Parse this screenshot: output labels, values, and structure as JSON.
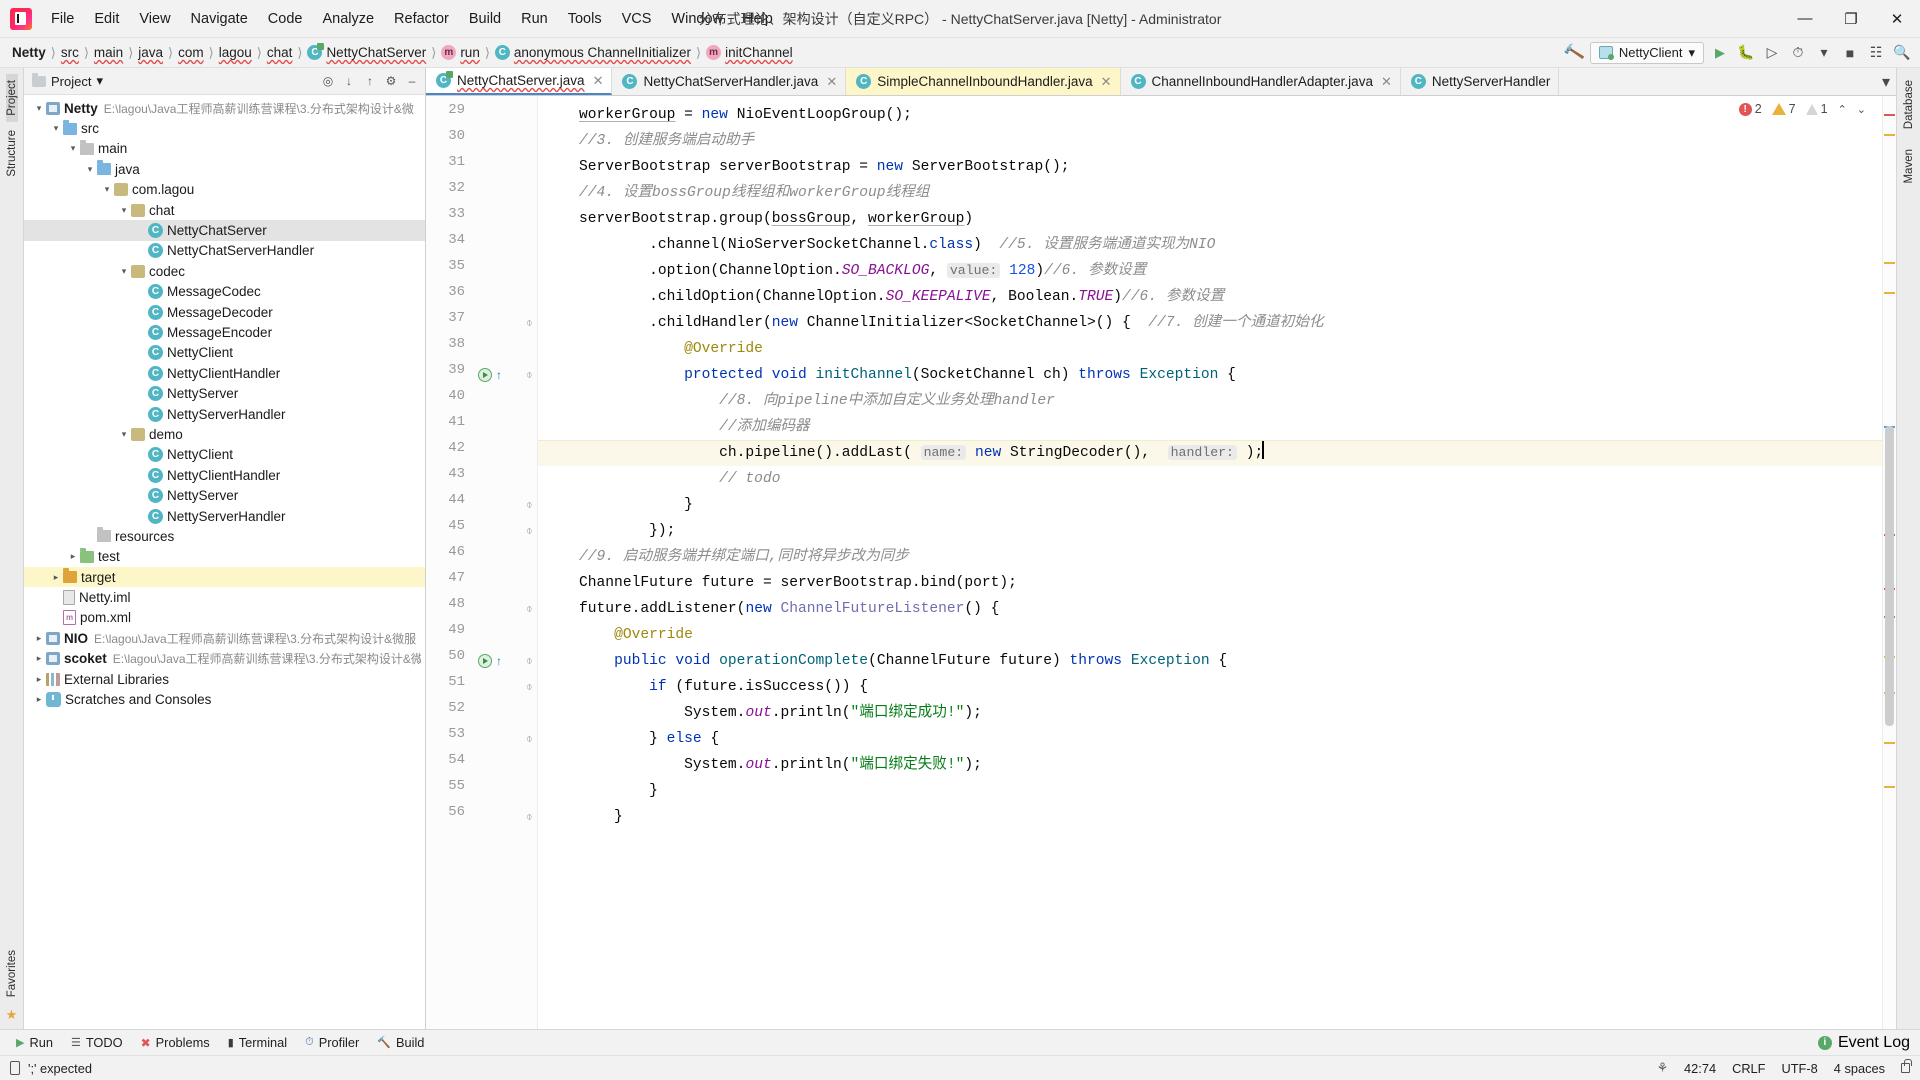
{
  "window": {
    "title": "分布式理论、架构设计（自定义RPC） - NettyChatServer.java [Netty] - Administrator",
    "minimize": "—",
    "maximize": "❐",
    "close": "✕"
  },
  "menubar": [
    {
      "label": "File"
    },
    {
      "label": "Edit"
    },
    {
      "label": "View"
    },
    {
      "label": "Navigate"
    },
    {
      "label": "Code"
    },
    {
      "label": "Analyze"
    },
    {
      "label": "Refactor"
    },
    {
      "label": "Build"
    },
    {
      "label": "Run"
    },
    {
      "label": "Tools"
    },
    {
      "label": "VCS"
    },
    {
      "label": "Window"
    },
    {
      "label": "Help"
    }
  ],
  "breadcrumb": [
    {
      "label": "Netty",
      "icon": "none",
      "bold": true,
      "wavy": false
    },
    {
      "label": "src",
      "icon": "none",
      "bold": false,
      "wavy": true
    },
    {
      "label": "main",
      "icon": "none",
      "bold": false,
      "wavy": true
    },
    {
      "label": "java",
      "icon": "none",
      "bold": false,
      "wavy": true
    },
    {
      "label": "com",
      "icon": "none",
      "bold": false,
      "wavy": true
    },
    {
      "label": "lagou",
      "icon": "none",
      "bold": false,
      "wavy": true
    },
    {
      "label": "chat",
      "icon": "none",
      "bold": false,
      "wavy": true
    },
    {
      "label": "NettyChatServer",
      "icon": "class",
      "bold": false,
      "wavy": true
    },
    {
      "label": "run",
      "icon": "method",
      "bold": false,
      "wavy": true
    },
    {
      "label": "anonymous ChannelInitializer",
      "icon": "anon",
      "bold": false,
      "wavy": true
    },
    {
      "label": "initChannel",
      "icon": "method",
      "bold": false,
      "wavy": true
    }
  ],
  "toolbar_right": {
    "hammer_icon": "build-hammer-icon",
    "run_config": "NettyClient",
    "dropdown_caret": "▾",
    "run_icon": "▶",
    "debug_icon": "debug-icon",
    "coverage_icon": "coverage-icon",
    "profile_icon": "profile-icon",
    "profile_caret": "▾",
    "stop_icon": "■",
    "layout_icon": "layout-icon",
    "search_icon": "⚲"
  },
  "left_rail": [
    "Project",
    "Structure",
    "Favorites"
  ],
  "right_rail": [
    "Database",
    "Maven"
  ],
  "project_panel": {
    "title": "Project",
    "caret": "▾",
    "actions": [
      "target-icon",
      "collapse-icon",
      "expand-icon",
      "settings-icon",
      "hide-icon"
    ],
    "tree": [
      {
        "depth": 0,
        "arrow": "open",
        "icon": "module",
        "label": "Netty",
        "sub": "E:\\lagou\\Java工程师高薪训练营课程\\3.分布式架构设计&微",
        "bold": true,
        "state": "normal"
      },
      {
        "depth": 1,
        "arrow": "open",
        "icon": "folder-blue",
        "label": "src",
        "sub": "",
        "state": "normal"
      },
      {
        "depth": 2,
        "arrow": "open",
        "icon": "folder-gray",
        "label": "main",
        "sub": "",
        "state": "normal"
      },
      {
        "depth": 3,
        "arrow": "open",
        "icon": "folder-blue",
        "label": "java",
        "sub": "",
        "state": "normal"
      },
      {
        "depth": 4,
        "arrow": "open",
        "icon": "package",
        "label": "com.lagou",
        "sub": "",
        "state": "normal"
      },
      {
        "depth": 5,
        "arrow": "open",
        "icon": "package",
        "label": "chat",
        "sub": "",
        "state": "normal"
      },
      {
        "depth": 6,
        "arrow": "none",
        "icon": "class",
        "label": "NettyChatServer",
        "sub": "",
        "state": "selected"
      },
      {
        "depth": 6,
        "arrow": "none",
        "icon": "class",
        "label": "NettyChatServerHandler",
        "sub": "",
        "state": "normal"
      },
      {
        "depth": 5,
        "arrow": "open",
        "icon": "package",
        "label": "codec",
        "sub": "",
        "state": "normal"
      },
      {
        "depth": 6,
        "arrow": "none",
        "icon": "class",
        "label": "MessageCodec",
        "sub": "",
        "state": "normal"
      },
      {
        "depth": 6,
        "arrow": "none",
        "icon": "class",
        "label": "MessageDecoder",
        "sub": "",
        "state": "normal"
      },
      {
        "depth": 6,
        "arrow": "none",
        "icon": "class",
        "label": "MessageEncoder",
        "sub": "",
        "state": "normal"
      },
      {
        "depth": 6,
        "arrow": "none",
        "icon": "class",
        "label": "NettyClient",
        "sub": "",
        "state": "normal"
      },
      {
        "depth": 6,
        "arrow": "none",
        "icon": "class",
        "label": "NettyClientHandler",
        "sub": "",
        "state": "normal"
      },
      {
        "depth": 6,
        "arrow": "none",
        "icon": "class",
        "label": "NettyServer",
        "sub": "",
        "state": "normal"
      },
      {
        "depth": 6,
        "arrow": "none",
        "icon": "class",
        "label": "NettyServerHandler",
        "sub": "",
        "state": "normal"
      },
      {
        "depth": 5,
        "arrow": "open",
        "icon": "package",
        "label": "demo",
        "sub": "",
        "state": "normal"
      },
      {
        "depth": 6,
        "arrow": "none",
        "icon": "class",
        "label": "NettyClient",
        "sub": "",
        "state": "normal"
      },
      {
        "depth": 6,
        "arrow": "none",
        "icon": "class",
        "label": "NettyClientHandler",
        "sub": "",
        "state": "normal"
      },
      {
        "depth": 6,
        "arrow": "none",
        "icon": "class",
        "label": "NettyServer",
        "sub": "",
        "state": "normal"
      },
      {
        "depth": 6,
        "arrow": "none",
        "icon": "class",
        "label": "NettyServerHandler",
        "sub": "",
        "state": "normal"
      },
      {
        "depth": 3,
        "arrow": "none",
        "icon": "folder-gray",
        "label": "resources",
        "sub": "",
        "state": "normal"
      },
      {
        "depth": 2,
        "arrow": "closed",
        "icon": "folder-green",
        "label": "test",
        "sub": "",
        "state": "normal"
      },
      {
        "depth": 1,
        "arrow": "closed",
        "icon": "folder-orange",
        "label": "target",
        "sub": "",
        "state": "highlight"
      },
      {
        "depth": 1,
        "arrow": "none",
        "icon": "file",
        "label": "Netty.iml",
        "sub": "",
        "state": "normal"
      },
      {
        "depth": 1,
        "arrow": "none",
        "icon": "xml",
        "label": "pom.xml",
        "sub": "",
        "state": "normal"
      },
      {
        "depth": 0,
        "arrow": "closed",
        "icon": "module",
        "label": "NIO",
        "sub": "E:\\lagou\\Java工程师高薪训练营课程\\3.分布式架构设计&微服",
        "bold": true,
        "state": "normal"
      },
      {
        "depth": 0,
        "arrow": "closed",
        "icon": "module",
        "label": "scoket",
        "sub": "E:\\lagou\\Java工程师高薪训练营课程\\3.分布式架构设计&微",
        "bold": true,
        "state": "normal"
      },
      {
        "depth": 0,
        "arrow": "closed",
        "icon": "library",
        "label": "External Libraries",
        "sub": "",
        "state": "normal"
      },
      {
        "depth": 0,
        "arrow": "closed",
        "icon": "scratch",
        "label": "Scratches and Consoles",
        "sub": "",
        "state": "normal"
      }
    ]
  },
  "editor": {
    "tabs": [
      {
        "label": "NettyChatServer.java",
        "icon": "class-run",
        "active": true,
        "wavy": true,
        "closable": true,
        "yellow": false
      },
      {
        "label": "NettyChatServerHandler.java",
        "icon": "class",
        "active": false,
        "wavy": false,
        "closable": true,
        "yellow": false
      },
      {
        "label": "SimpleChannelInboundHandler.java",
        "icon": "class",
        "active": false,
        "wavy": false,
        "closable": true,
        "yellow": true
      },
      {
        "label": "ChannelInboundHandlerAdapter.java",
        "icon": "class",
        "active": false,
        "wavy": false,
        "closable": true,
        "yellow": false
      },
      {
        "label": "NettyServerHandler",
        "icon": "class",
        "active": false,
        "wavy": false,
        "closable": false,
        "yellow": false
      }
    ],
    "tab_overflow": "▾",
    "inspection": {
      "errors": "2",
      "warnings": "7",
      "weak_warnings": "1",
      "error_glyph": "!",
      "caret_up": "⌃",
      "caret_down": "⌄"
    },
    "first_line_number": 29,
    "lines": [
      {
        "n": 29,
        "gutter": [],
        "fold": false,
        "hl": false,
        "text_html": "    <span class='uline'>workerGroup</span> = <span class='kw'>new</span> NioEventLoopGroup();"
      },
      {
        "n": 30,
        "gutter": [],
        "fold": false,
        "hl": false,
        "text_html": "    <span class='cmt'>//3. 创建服务端启动助手</span>"
      },
      {
        "n": 31,
        "gutter": [],
        "fold": false,
        "hl": false,
        "text_html": "    ServerBootstrap serverBootstrap = <span class='kw'>new</span> ServerBootstrap();"
      },
      {
        "n": 32,
        "gutter": [],
        "fold": false,
        "hl": false,
        "text_html": "    <span class='cmt'>//4. 设置bossGroup线程组和workerGroup线程组</span>"
      },
      {
        "n": 33,
        "gutter": [],
        "fold": false,
        "hl": false,
        "text_html": "    serverBootstrap.group(<span class='uline'>bossGroup</span>, <span class='uline'>workerGroup</span>)"
      },
      {
        "n": 34,
        "gutter": [],
        "fold": false,
        "hl": false,
        "text_html": "            .channel(NioServerSocketChannel.<span class='kw'>class</span>)  <span class='cmt'>//5. 设置服务端通道实现为NIO</span>"
      },
      {
        "n": 35,
        "gutter": [],
        "fold": false,
        "hl": false,
        "text_html": "            .option(ChannelOption.<span class='field'>SO_BACKLOG</span>, <span class='param-hint'>value:</span> <span class='num'>128</span>)<span class='cmt'>//6. 参数设置</span>"
      },
      {
        "n": 36,
        "gutter": [],
        "fold": false,
        "hl": false,
        "text_html": "            .childOption(ChannelOption.<span class='field'>SO_KEEPALIVE</span>, Boolean.<span class='field'>TRUE</span>)<span class='cmt'>//6. 参数设置</span>"
      },
      {
        "n": 37,
        "gutter": [],
        "fold": true,
        "hl": false,
        "text_html": "            .childHandler(<span class='kw'>new</span> ChannelInitializer&lt;SocketChannel&gt;() {  <span class='cmt'>//7. 创建一个通道初始化</span>"
      },
      {
        "n": 38,
        "gutter": [],
        "fold": false,
        "hl": false,
        "text_html": "                <span class='ann'>@Override</span>"
      },
      {
        "n": 39,
        "gutter": [
          "run",
          "ovr"
        ],
        "fold": true,
        "hl": false,
        "text_html": "                <span class='kw'>protected</span> <span class='kw'>void</span> <span class='meth'>initChannel</span>(SocketChannel ch) <span class='kw'>throws</span> <span class='meth'>Exception</span> {"
      },
      {
        "n": 40,
        "gutter": [],
        "fold": false,
        "hl": false,
        "text_html": "                    <span class='cmt'>//8. 向pipeline中添加自定义业务处理handler</span>"
      },
      {
        "n": 41,
        "gutter": [],
        "fold": false,
        "hl": false,
        "text_html": "                    <span class='cmt'>//添加编码器</span>"
      },
      {
        "n": 42,
        "gutter": [],
        "fold": false,
        "hl": true,
        "text_html": "                    ch.pipeline().addLast( <span class='param-hint'>name:</span> <span class='kw'>new</span> StringDecoder(),  <span class='param-hint'>handler:</span> );<span class='caret'></span>"
      },
      {
        "n": 43,
        "gutter": [],
        "fold": false,
        "hl": false,
        "text_html": "                    <span class='cmt'>// todo</span>"
      },
      {
        "n": 44,
        "gutter": [],
        "fold": true,
        "hl": false,
        "text_html": "                }"
      },
      {
        "n": 45,
        "gutter": [],
        "fold": true,
        "hl": false,
        "text_html": "            });"
      },
      {
        "n": 46,
        "gutter": [],
        "fold": false,
        "hl": false,
        "text_html": "    <span class='cmt'>//9. 启动服务端并绑定端口,同时将异步改为同步</span>"
      },
      {
        "n": 47,
        "gutter": [],
        "fold": false,
        "hl": false,
        "text_html": "    ChannelFuture future = serverBootstrap.bind(port);"
      },
      {
        "n": 48,
        "gutter": [],
        "fold": true,
        "hl": false,
        "text_html": "    future.addListener(<span class='kw'>new</span> <span style='color:#6f6fb0'>ChannelFutureListener</span>() {"
      },
      {
        "n": 49,
        "gutter": [],
        "fold": false,
        "hl": false,
        "text_html": "        <span class='ann'>@Override</span>"
      },
      {
        "n": 50,
        "gutter": [
          "run",
          "ovr"
        ],
        "fold": true,
        "hl": false,
        "text_html": "        <span class='kw'>public</span> <span class='kw'>void</span> <span class='meth'>operationComplete</span>(ChannelFuture future) <span class='kw'>throws</span> <span class='meth'>Exception</span> {"
      },
      {
        "n": 51,
        "gutter": [],
        "fold": true,
        "hl": false,
        "text_html": "            <span class='kw'>if</span> (future.isSuccess()) {"
      },
      {
        "n": 52,
        "gutter": [],
        "fold": false,
        "hl": false,
        "text_html": "                System.<span class='field'>out</span>.println(<span class='str'>\"端口绑定成功!\"</span>);"
      },
      {
        "n": 53,
        "gutter": [],
        "fold": true,
        "hl": false,
        "text_html": "            } <span class='kw'>else</span> {"
      },
      {
        "n": 54,
        "gutter": [],
        "fold": false,
        "hl": false,
        "text_html": "                System.<span class='field'>out</span>.println(<span class='str'>\"端口绑定失败!\"</span>);"
      },
      {
        "n": 55,
        "gutter": [],
        "fold": false,
        "hl": false,
        "text_html": "            }"
      },
      {
        "n": 56,
        "gutter": [],
        "fold": true,
        "hl": false,
        "text_html": "        }"
      }
    ]
  },
  "bottom_tools": [
    {
      "label": "Run",
      "icon": "run-icon"
    },
    {
      "label": "TODO",
      "icon": "todo-icon"
    },
    {
      "label": "Problems",
      "icon": "problems-icon"
    },
    {
      "label": "Terminal",
      "icon": "terminal-icon"
    },
    {
      "label": "Profiler",
      "icon": "profiler-icon"
    },
    {
      "label": "Build",
      "icon": "build-icon"
    }
  ],
  "event_log": "Event Log",
  "status": {
    "message": "';' expected",
    "caret_position": "42:74",
    "line_separator": "CRLF",
    "encoding": "UTF-8",
    "indent": "4 spaces"
  }
}
